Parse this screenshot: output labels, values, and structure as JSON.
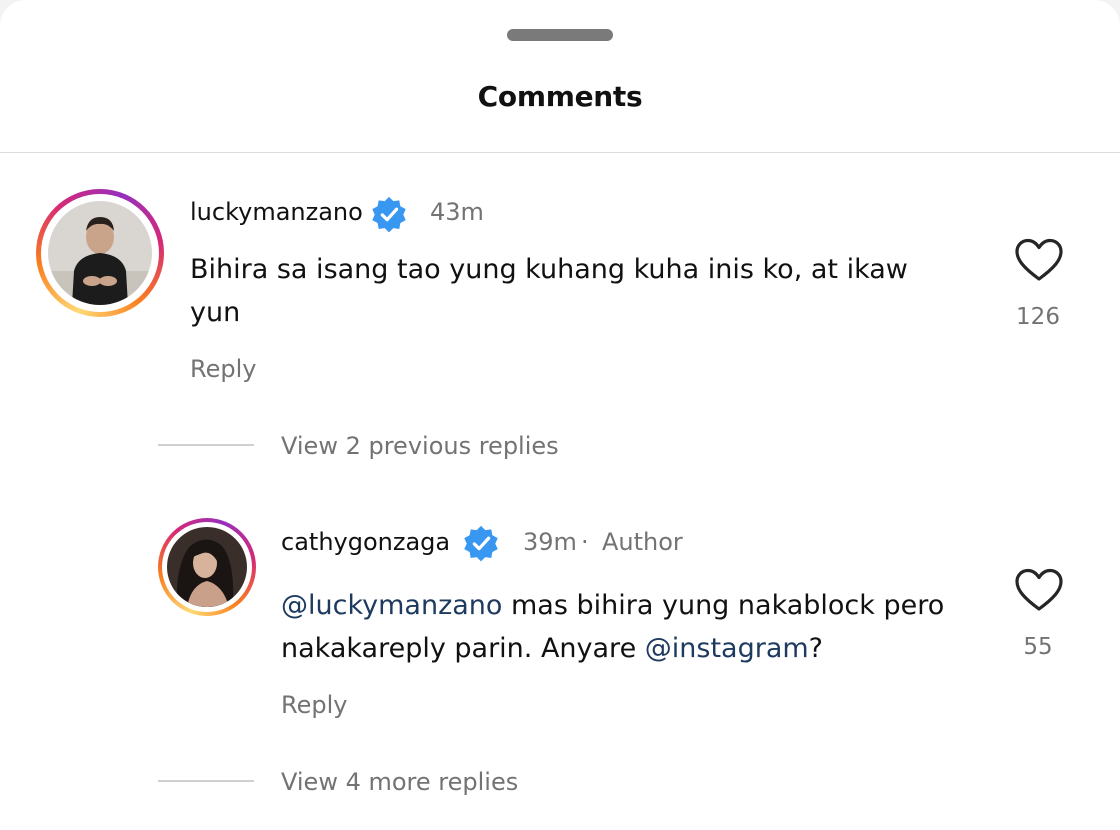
{
  "header": {
    "title": "Comments"
  },
  "comments": [
    {
      "username": "luckymanzano",
      "time": "43m",
      "text": "Bihira sa isang tao yung kuhang kuha inis ko, at ikaw yun",
      "reply_label": "Reply",
      "likes": "126",
      "view_replies_label": "View 2 previous replies"
    },
    {
      "username": "cathygonzaga",
      "time": "39m",
      "separator": "·",
      "author_badge": "Author",
      "mention_1": "@luckymanzano",
      "text_1": " mas bihira yung nakablock pero nakakareply parin. Anyare ",
      "mention_2": "@instagram",
      "text_2": "?",
      "reply_label": "Reply",
      "likes": "55",
      "view_replies_label": "View 4 more replies"
    }
  ],
  "icons": {
    "verified": "verified-badge-icon",
    "like": "heart-outline-icon"
  },
  "colors": {
    "verified_blue": "#3897f0",
    "mention": "#1e3a5f",
    "secondary_text": "#737373"
  }
}
